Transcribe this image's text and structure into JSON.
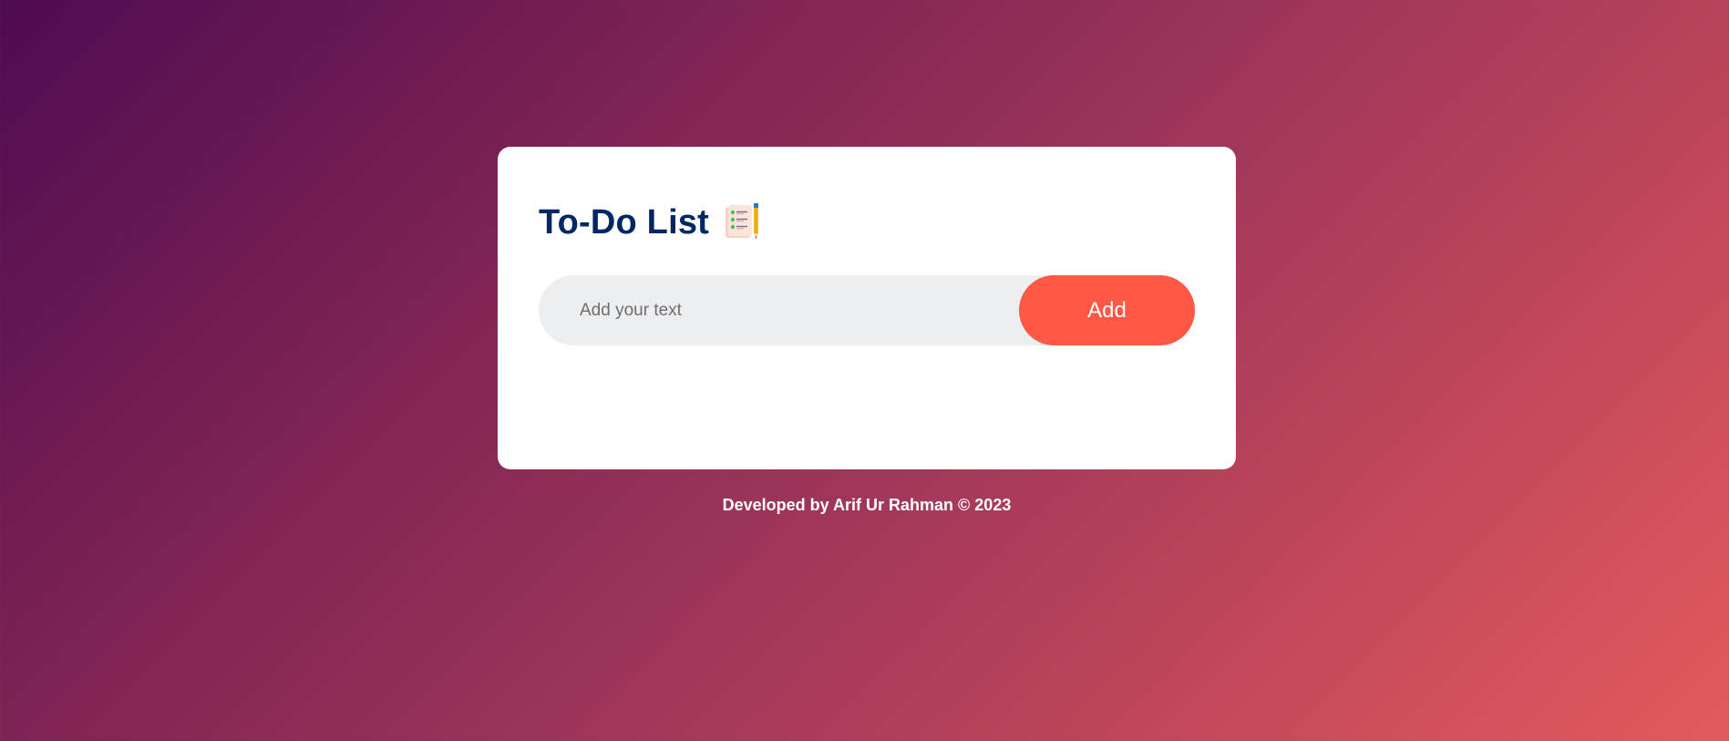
{
  "app": {
    "title": "To-Do List",
    "title_icon": "notepad-pencil-icon"
  },
  "input": {
    "placeholder": "Add your text",
    "value": ""
  },
  "buttons": {
    "add_label": "Add"
  },
  "tasks": [],
  "footer": {
    "text": "Developed by Arif Ur Rahman © 2023"
  },
  "colors": {
    "title": "#002765",
    "button": "#ff5945",
    "input_bg": "#edeef0",
    "gradient_start": "#4e0b52",
    "gradient_end": "#e35b5d"
  }
}
